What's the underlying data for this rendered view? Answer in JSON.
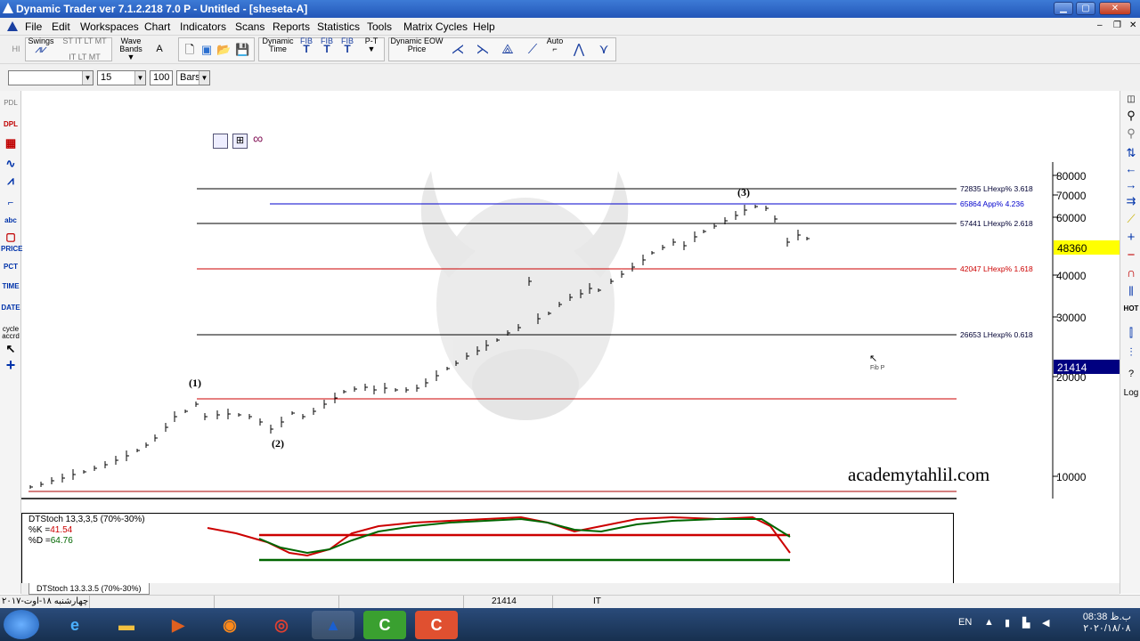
{
  "window": {
    "title": "Dynamic Trader ver 7.1.2.218 7.0 P - Untitled - [sheseta-A]"
  },
  "menu": [
    "File",
    "Edit",
    "Workspaces",
    "Chart",
    "Indicators",
    "Scans",
    "Reports",
    "Statistics",
    "Tools",
    "Matrix Cycles",
    "Help"
  ],
  "toolbar": {
    "hi": "HI",
    "swings": "Swings",
    "st_it_lt_mt_1": "ST IT LT MT",
    "st_it_lt_mt_2": "IT LT MT",
    "wave_bands": "Wave Bands",
    "a_label": "A",
    "dynamic_time": "Dynamic Time",
    "fib1": "FIB",
    "fib2": "FIB",
    "fib3": "FIB",
    "pt": "P-T",
    "dynamic_eow": "Dynamic EOW Price",
    "auto": "Auto"
  },
  "toolbar2": {
    "symbol_value": "",
    "period_value": "15",
    "bars_count": "100",
    "bars_unit": "Bars"
  },
  "left_tools": {
    "pdl": "PDL",
    "dpl": "DPL",
    "abc": "abc",
    "price": "PRICE",
    "pct": "PCT",
    "time": "TIME",
    "date": "DATE",
    "cycle": "cycle",
    "accrd": "accrd"
  },
  "right_tools": {
    "hot": "HOT",
    "log": "Log"
  },
  "chart": {
    "watermark": "academytahlil.com",
    "current_price": "48360",
    "crosshair_price": "21414",
    "y_axis_ticks": [
      "80000",
      "70000",
      "60000",
      "40000",
      "30000",
      "20000",
      "10000"
    ],
    "wave_labels": [
      "(1)",
      "(2)",
      "(3)"
    ],
    "fib_levels": [
      {
        "label": "72835 LHexp% 3.618",
        "color": "#000000"
      },
      {
        "label": "65864 App% 4.236",
        "color": "#0000cc"
      },
      {
        "label": "57441 LHexp% 2.618",
        "color": "#000000"
      },
      {
        "label": "42047 LHexp% 1.618",
        "color": "#cc0000"
      },
      {
        "label": "26653 LHexp% 0.618",
        "color": "#000000"
      }
    ],
    "cursor_label": "Fib P"
  },
  "stochastic": {
    "title": "DTStoch 13,3,3,5 (70%-30%)",
    "k_label": "%K =",
    "k_value": "41.54",
    "d_label": "%D =",
    "d_value": "64.76",
    "tab_label": "DTStoch 13.3.3.5 (70%-30%)"
  },
  "status": {
    "date_text": "چهارشنبه ۱۸-اوت-۲۰۱۷",
    "price": "21414",
    "mode": "IT"
  },
  "taskbar": {
    "lang": "EN",
    "time": "08:38 ب.ظ",
    "date": "۲۰۲۰/۱۸/۰۸"
  }
}
